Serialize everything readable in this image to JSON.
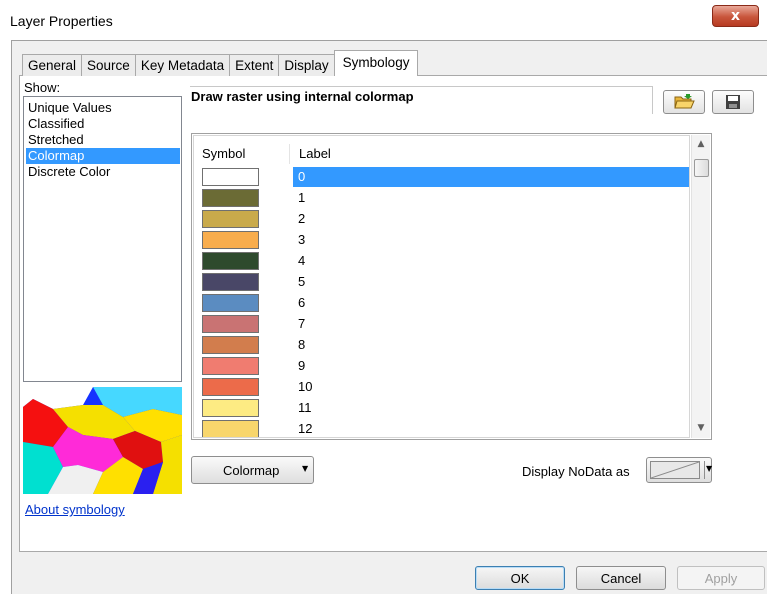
{
  "window": {
    "title": "Layer Properties",
    "close_glyph": "x"
  },
  "tabs": [
    {
      "label": "General",
      "active": false
    },
    {
      "label": "Source",
      "active": false
    },
    {
      "label": "Key Metadata",
      "active": false
    },
    {
      "label": "Extent",
      "active": false
    },
    {
      "label": "Display",
      "active": false
    },
    {
      "label": "Symbology",
      "active": true
    }
  ],
  "show": {
    "label": "Show:",
    "items": [
      {
        "label": "Unique Values",
        "selected": false
      },
      {
        "label": "Classified",
        "selected": false
      },
      {
        "label": "Stretched",
        "selected": false
      },
      {
        "label": "Colormap",
        "selected": true
      },
      {
        "label": "Discrete Color",
        "selected": false
      }
    ]
  },
  "about_link": "About symbology",
  "panel": {
    "heading": "Draw raster using internal colormap",
    "open_icon": "folder-open-icon",
    "save_icon": "save-disk-icon"
  },
  "table": {
    "columns": [
      "Symbol",
      "Label"
    ],
    "rows": [
      {
        "label": "0",
        "color": "#ffffff",
        "selected": true
      },
      {
        "label": "1",
        "color": "#6b6b35",
        "selected": false
      },
      {
        "label": "2",
        "color": "#c9aa4b",
        "selected": false
      },
      {
        "label": "3",
        "color": "#f8ad4d",
        "selected": false
      },
      {
        "label": "4",
        "color": "#2e4a2d",
        "selected": false
      },
      {
        "label": "5",
        "color": "#494767",
        "selected": false
      },
      {
        "label": "6",
        "color": "#5b8cc1",
        "selected": false
      },
      {
        "label": "7",
        "color": "#c97373",
        "selected": false
      },
      {
        "label": "8",
        "color": "#d27d4d",
        "selected": false
      },
      {
        "label": "9",
        "color": "#f07c70",
        "selected": false
      },
      {
        "label": "10",
        "color": "#ec6b4a",
        "selected": false
      },
      {
        "label": "11",
        "color": "#fdeb83",
        "selected": false
      },
      {
        "label": "12",
        "color": "#f8d66c",
        "selected": false
      }
    ]
  },
  "colormap_button": "Colormap",
  "nodata": {
    "label": "Display NoData as"
  },
  "buttons": {
    "ok": "OK",
    "cancel": "Cancel",
    "apply": "Apply"
  },
  "colors": {
    "selection": "#3399ff",
    "link": "#0033cc"
  }
}
